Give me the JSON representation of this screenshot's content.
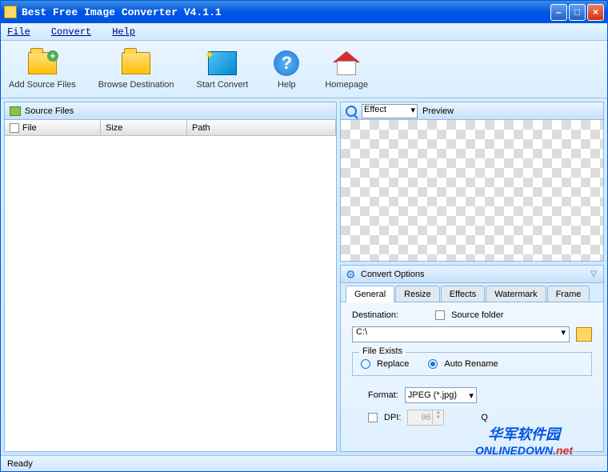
{
  "title": "Best Free Image Converter V4.1.1",
  "menu": {
    "file": "File",
    "convert": "Convert",
    "help": "Help"
  },
  "toolbar": {
    "add_source": "Add Source Files",
    "browse_dest": "Browse Destination",
    "start_convert": "Start Convert",
    "help": "Help",
    "homepage": "Homepage"
  },
  "source_panel": {
    "title": "Source Files",
    "columns": {
      "file": "File",
      "size": "Size",
      "path": "Path"
    }
  },
  "preview_panel": {
    "effect_label": "Effect",
    "preview_label": "Preview"
  },
  "options_panel": {
    "title": "Convert Options",
    "tabs": [
      "General",
      "Resize",
      "Effects",
      "Watermark",
      "Frame"
    ],
    "active_tab": 0,
    "general": {
      "destination_label": "Destination:",
      "source_folder_label": "Source folder",
      "destination_value": "C:\\",
      "file_exists_label": "File Exists",
      "replace_label": "Replace",
      "auto_rename_label": "Auto Rename",
      "file_exists_selected": "auto_rename",
      "format_label": "Format:",
      "format_value": "JPEG (*.jpg)",
      "dpi_label": "DPI:",
      "dpi_value": "96",
      "quality_label": "Q"
    }
  },
  "statusbar": {
    "text": "Ready"
  },
  "watermark": {
    "cn": "华军软件园",
    "en": "ONLINEDOWN",
    "tld": ".net"
  }
}
